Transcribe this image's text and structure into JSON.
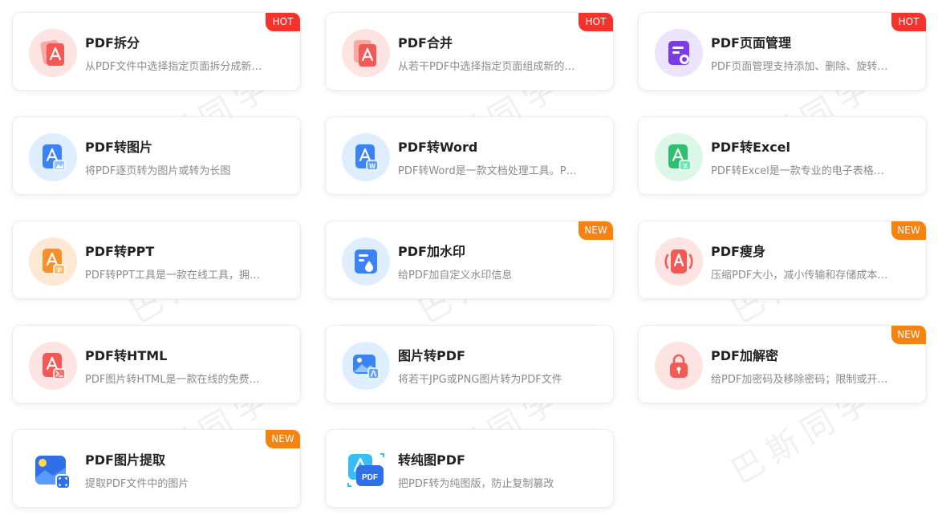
{
  "watermark_text": "巴斯同学",
  "tools": [
    {
      "title": "PDF拆分",
      "desc": "从PDF文件中选择指定页面拆分成新…",
      "badge": "HOT",
      "icon": "split-pdf-icon"
    },
    {
      "title": "PDF合并",
      "desc": "从若干PDF中选择指定页面组成新的…",
      "badge": "HOT",
      "icon": "merge-pdf-icon"
    },
    {
      "title": "PDF页面管理",
      "desc": "PDF页面管理支持添加、删除、旋转…",
      "badge": "HOT",
      "icon": "page-manage-icon"
    },
    {
      "title": "PDF转图片",
      "desc": "将PDF逐页转为图片或转为长图",
      "badge": "",
      "icon": "pdf-to-image-icon"
    },
    {
      "title": "PDF转Word",
      "desc": "PDF转Word是一款文档处理工具。P…",
      "badge": "",
      "icon": "pdf-to-word-icon"
    },
    {
      "title": "PDF转Excel",
      "desc": "PDF转Excel是一款专业的电子表格…",
      "badge": "",
      "icon": "pdf-to-excel-icon"
    },
    {
      "title": "PDF转PPT",
      "desc": "PDF转PPT工具是一款在线工具，拥…",
      "badge": "",
      "icon": "pdf-to-ppt-icon"
    },
    {
      "title": "PDF加水印",
      "desc": "给PDF加自定义水印信息",
      "badge": "NEW",
      "icon": "watermark-icon"
    },
    {
      "title": "PDF瘦身",
      "desc": "压缩PDF大小，减小传输和存储成本…",
      "badge": "NEW",
      "icon": "compress-pdf-icon"
    },
    {
      "title": "PDF转HTML",
      "desc": "PDF图片转HTML是一款在线的免费…",
      "badge": "",
      "icon": "pdf-to-html-icon"
    },
    {
      "title": "图片转PDF",
      "desc": "将若干JPG或PNG图片转为PDF文件",
      "badge": "",
      "icon": "image-to-pdf-icon"
    },
    {
      "title": "PDF加解密",
      "desc": "给PDF加密码及移除密码；限制或开…",
      "badge": "NEW",
      "icon": "lock-icon"
    },
    {
      "title": "PDF图片提取",
      "desc": "提取PDF文件中的图片",
      "badge": "NEW",
      "icon": "extract-image-icon"
    },
    {
      "title": "转纯图PDF",
      "desc": "把PDF转为纯图版，防止复制篡改",
      "badge": "",
      "icon": "pure-image-pdf-icon"
    }
  ],
  "pdf_label": "PDF",
  "colors": {
    "hot": "#f5322c",
    "new": "#f7820f",
    "red_bg": "#fde3e1",
    "red": "#f35a55",
    "blue_bg": "#dfeefe",
    "blue": "#3b82f6",
    "purple_bg": "#ece3fd",
    "purple": "#7c3aed",
    "green_bg": "#dcf6e8",
    "green": "#2fbf71",
    "orange_bg": "#fde8d4",
    "orange": "#f5902c"
  }
}
